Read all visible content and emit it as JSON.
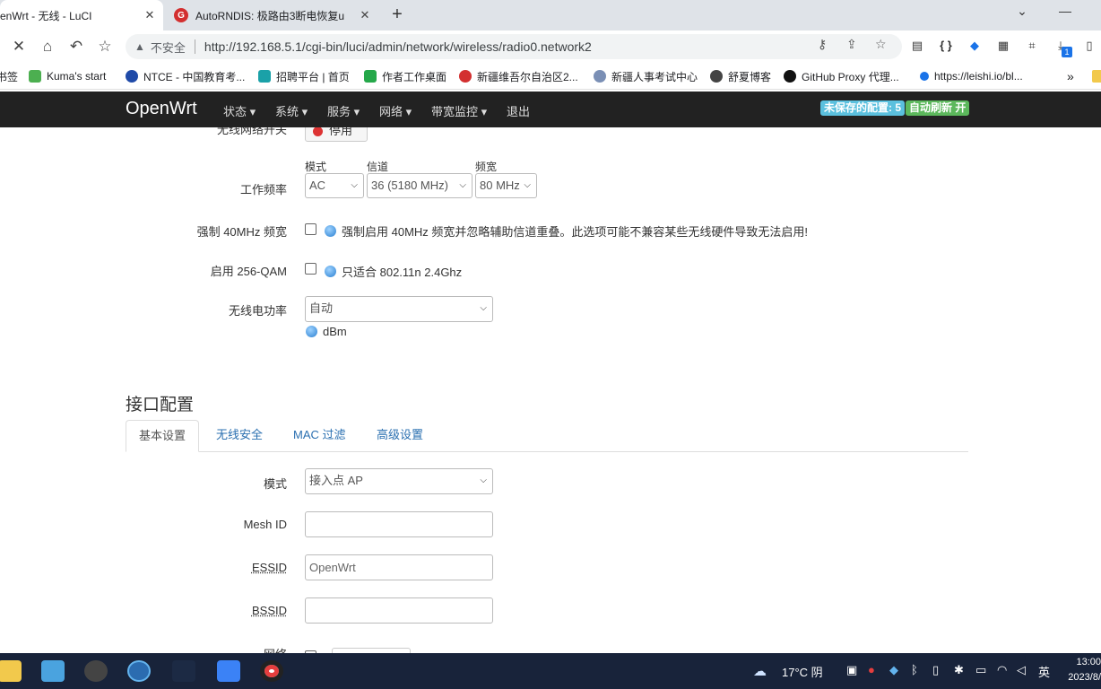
{
  "browser": {
    "tabs": [
      {
        "title": "enWrt - 无线 - LuCI",
        "active": true
      },
      {
        "title": "AutoRNDIS: 极路由3断电恢复u",
        "active": false
      }
    ],
    "new_tab": "+",
    "insecure_label": "不安全",
    "url": "http://192.168.5.1/cgi-bin/luci/admin/network/wireless/radio0.network2",
    "download_badge": "1"
  },
  "bookmarks": [
    {
      "label": "书签",
      "color": "#f2b400"
    },
    {
      "label": "Kuma's start",
      "color": "#4caf50"
    },
    {
      "label": "NTCE - 中国教育考...",
      "color": "#1f4aa8"
    },
    {
      "label": "招聘平台 | 首页",
      "color": "#1aa1a8"
    },
    {
      "label": "作者工作桌面",
      "color": "#25a84a"
    },
    {
      "label": "新疆维吾尔自治区2...",
      "color": "#d32f2f"
    },
    {
      "label": "新疆人事考试中心",
      "color": "#7a8fb5"
    },
    {
      "label": "舒夏博客",
      "color": "#444444"
    },
    {
      "label": "GitHub Proxy 代理...",
      "color": "#111111"
    },
    {
      "label": "https://leishi.io/bl...",
      "color": "#1a73e8"
    }
  ],
  "openwrt": {
    "brand": "OpenWrt",
    "menu": [
      "状态 ▾",
      "系统 ▾",
      "服务 ▾",
      "网络 ▾",
      "带宽监控 ▾",
      "退出"
    ],
    "badge_unsaved": "未保存的配置: 5",
    "badge_refresh": "自动刷新 开"
  },
  "device": {
    "wireless_toggle_label": "无线网络开关",
    "disable_button": "停用",
    "freq_label": "工作频率",
    "mode_caption": "模式",
    "channel_caption": "信道",
    "width_caption": "频宽",
    "mode_value": "AC",
    "channel_value": "36 (5180 MHz)",
    "width_value": "80 MHz",
    "force40_label": "强制 40MHz 频宽",
    "force40_help": "强制启用 40MHz 频宽并忽略辅助信道重叠。此选项可能不兼容某些无线硬件导致无法启用!",
    "qam_label": "启用 256-QAM",
    "qam_help": "只适合 802.11n 2.4Ghz",
    "power_label": "无线电功率",
    "power_value": "自动",
    "power_unit": "dBm"
  },
  "iface": {
    "title": "接口配置",
    "tabs": [
      "基本设置",
      "无线安全",
      "MAC 过滤",
      "高级设置"
    ],
    "mode_label": "模式",
    "mode_value": "接入点 AP",
    "mesh_label": "Mesh ID",
    "mesh_value": "",
    "essid_label": "ESSID",
    "essid_value": "OpenWrt",
    "bssid_label": "BSSID",
    "bssid_value": "",
    "network_label": "网络"
  },
  "taskbar": {
    "weather": "17°C 阴",
    "ime": "英",
    "time": "13:00",
    "date": "2023/8/"
  }
}
